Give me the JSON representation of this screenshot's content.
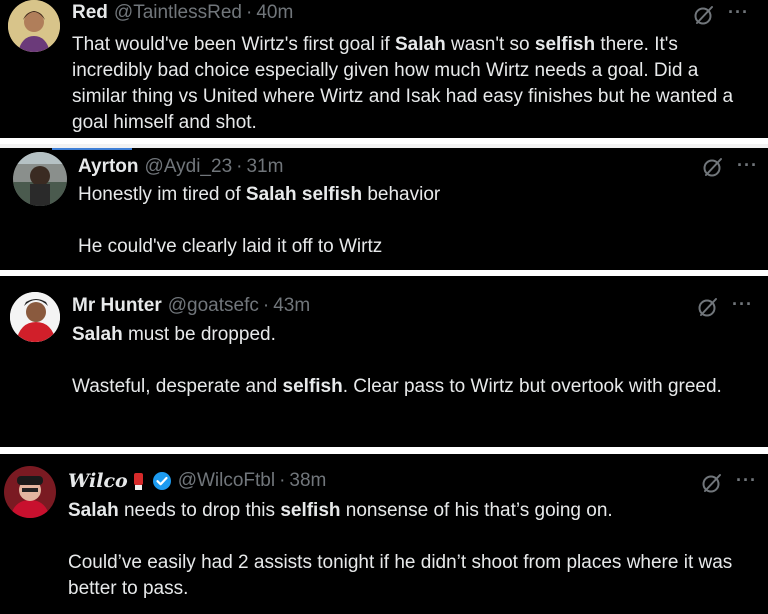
{
  "tweets": [
    {
      "name": "Red",
      "handle": "@TaintlessRed",
      "separator": "·",
      "time": "40m",
      "paragraphs": [
        [
          {
            "t": "That would've been Wirtz's first goal if "
          },
          {
            "t": "Salah",
            "b": true
          },
          {
            "t": " wasn't so "
          },
          {
            "t": "selfish",
            "b": true
          },
          {
            "t": " there. It's incredibly bad choice especially given how much Wirtz needs a goal. Did a similar thing vs United where Wirtz and Isak had easy finishes but he wanted a goal himself and shot."
          }
        ]
      ]
    },
    {
      "name": "Ayrton",
      "handle": "@Aydi_23",
      "separator": "·",
      "time": "31m",
      "paragraphs": [
        [
          {
            "t": "Honestly im tired of "
          },
          {
            "t": "Salah selfish",
            "b": true
          },
          {
            "t": " behavior"
          }
        ],
        [
          {
            "t": "He could've clearly laid it off to Wirtz"
          }
        ]
      ]
    },
    {
      "name": "Mr Hunter",
      "handle": "@goatsefc",
      "separator": "·",
      "time": "43m",
      "paragraphs": [
        [
          {
            "t": "Salah",
            "b": true
          },
          {
            "t": " must be dropped."
          }
        ],
        [
          {
            "t": "Wasteful, desperate and "
          },
          {
            "t": "selfish",
            "b": true
          },
          {
            "t": ". Clear pass to Wirtz but overtook with greed."
          }
        ]
      ]
    },
    {
      "name": "Wilco",
      "handle": "@WilcoFtbl",
      "separator": "·",
      "time": "38m",
      "paragraphs": [
        [
          {
            "t": "Salah",
            "b": true
          },
          {
            "t": " needs to drop this "
          },
          {
            "t": "selfish",
            "b": true
          },
          {
            "t": " nonsense of his that’s going on."
          }
        ],
        [
          {
            "t": "Could’ve easily had 2 assists tonight if he didn’t shoot from places where it was better to pass."
          }
        ]
      ]
    }
  ],
  "icons": {
    "grok": "grok-slash-icon",
    "more": "more-options-icon",
    "verified": "verified-badge-icon",
    "emoji": "red-glove-emoji-icon",
    "more_glyph": "···"
  },
  "colors": {
    "background": "#000000",
    "text": "#e7e9ea",
    "muted": "#71767b",
    "verified": "#1d9bf0"
  }
}
